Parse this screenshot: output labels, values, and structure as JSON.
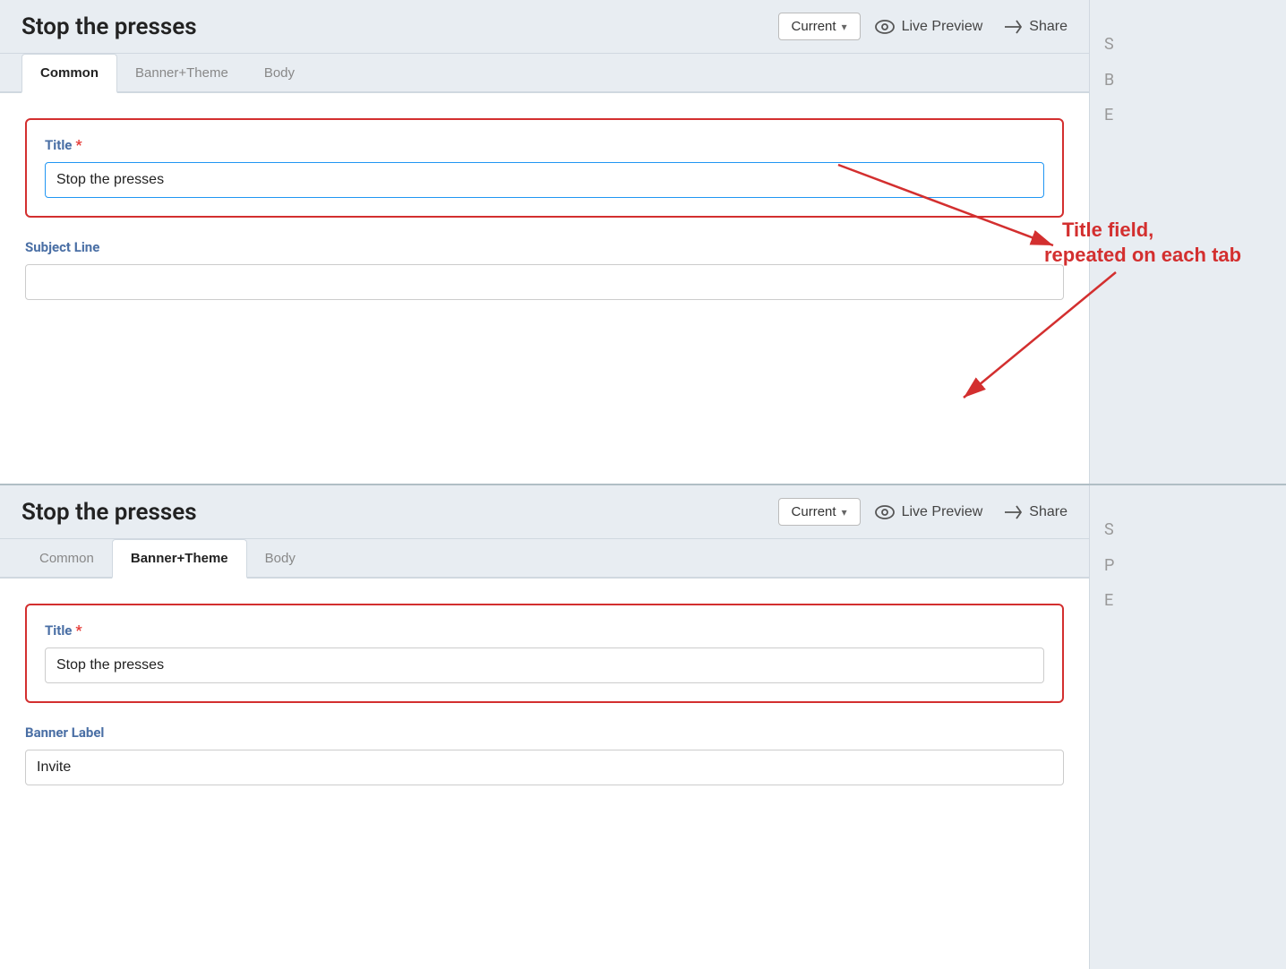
{
  "panel1": {
    "header": {
      "title": "Stop the presses",
      "version_label": "Current",
      "version_chevron": "▾",
      "live_preview_label": "Live Preview",
      "share_label": "Share"
    },
    "tabs": [
      {
        "id": "common",
        "label": "Common",
        "active": true
      },
      {
        "id": "banner-theme",
        "label": "Banner+Theme",
        "active": false
      },
      {
        "id": "body",
        "label": "Body",
        "active": false
      }
    ],
    "form": {
      "title_label": "Title",
      "title_required": "*",
      "title_value": "Stop the presses",
      "subject_line_label": "Subject Line",
      "subject_line_value": ""
    }
  },
  "panel2": {
    "header": {
      "title": "Stop the presses",
      "version_label": "Current",
      "version_chevron": "▾",
      "live_preview_label": "Live Preview",
      "share_label": "Share"
    },
    "tabs": [
      {
        "id": "common",
        "label": "Common",
        "active": false
      },
      {
        "id": "banner-theme",
        "label": "Banner+Theme",
        "active": true
      },
      {
        "id": "body",
        "label": "Body",
        "active": false
      }
    ],
    "form": {
      "title_label": "Title",
      "title_required": "*",
      "title_value": "Stop the presses",
      "banner_label_label": "Banner Label",
      "banner_label_value": "Invite"
    }
  },
  "annotation": {
    "text": "Title field, repeated on each tab"
  },
  "right_sidebar1": {
    "letters": [
      "S",
      "B",
      "E"
    ]
  },
  "right_sidebar2": {
    "letters": [
      "S",
      "P",
      "E"
    ]
  }
}
